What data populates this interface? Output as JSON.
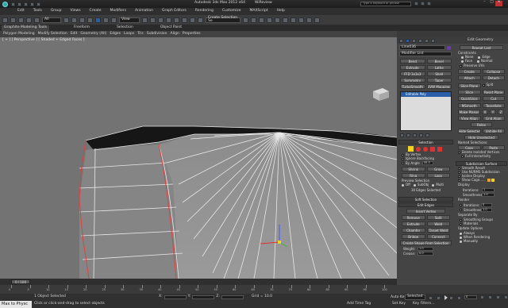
{
  "title_bar": {
    "title": "Autodesk 3ds Max 2012 x64",
    "file": "WiReview",
    "search_placeholder": "Type a keyword or phrase"
  },
  "menu": [
    "Edit",
    "Tools",
    "Group",
    "Views",
    "Create",
    "Modifiers",
    "Animation",
    "Graph Editors",
    "Rendering",
    "Customize",
    "MAXScript",
    "Help"
  ],
  "toolbar": {
    "selection_filter": "All",
    "ref_coord": "View",
    "named_selection": "Create Selection Se"
  },
  "ribbon_tabs": [
    "Graphite Modeling Tools",
    "Freeform",
    "Selection",
    "Object Paint"
  ],
  "ribbon_items": [
    "Polygon Modeling",
    "Modify Selection",
    "Edit",
    "Geometry (All)",
    "Edges",
    "Loops",
    "Tris",
    "Subdivision",
    "Align",
    "Properties"
  ],
  "viewport": {
    "label": "[ + ] [ Perspective ] [ Shaded + Edged Faces ]"
  },
  "command_panel": {
    "object_name": "Line036",
    "modifier_list": "Modifier List",
    "modifier_buttons": [
      "Bend",
      "Bevel",
      "Extrude",
      "Lathe",
      "FFD 3x3x3",
      "Shell",
      "Symmetry",
      "Taper",
      "TurboSmooth",
      "UVW Mapping Cle"
    ],
    "stack_item": "Editable Poly",
    "selection": {
      "title": "Selection",
      "by_vertex": "By Vertex",
      "ignore_backfacing": "Ignore Backfacing",
      "by_angle": "By Angle",
      "angle": "45.0",
      "shrink": "Shrink",
      "grow": "Grow",
      "ring": "Ring",
      "loop": "Loop",
      "preview": "Preview Selection",
      "off": "Off",
      "subobj": "SubObj",
      "multi": "Multi",
      "status": "30 Edges Selected"
    },
    "soft_selection": "Soft Selection",
    "edit_edges": {
      "title": "Edit Edges",
      "insert_vertex": "Insert Vertex",
      "remove": "Remove",
      "split": "Split",
      "extrude": "Extrude",
      "weld": "Weld",
      "chamfer": "Chamfer",
      "target_weld": "Target Weld",
      "bridge": "Bridge",
      "connect": "Connect",
      "create_shape": "Create Shape From Selection",
      "weight_label": "Weight:",
      "weight": "1.0",
      "crease_label": "Crease:",
      "crease": "0.0"
    }
  },
  "side_panel": {
    "edit_geometry": "Edit Geometry",
    "repeat_last": "Repeat Last",
    "constraints": "Constraints",
    "c_none": "None",
    "c_edge": "Edge",
    "c_face": "Face",
    "c_normal": "Normal",
    "preserve_uvs": "Preserve UVs",
    "create": "Create",
    "collapse": "Collapse",
    "attach": "Attach",
    "detach": "Detach",
    "slice_plane": "Slice Plane",
    "split": "Split",
    "slice": "Slice",
    "reset_plane": "Reset Plane",
    "quickslice": "QuickSlice",
    "cut": "Cut",
    "msmooth": "MSmooth",
    "tessellate": "Tessellate",
    "make_planar": "Make Planar",
    "x": "X",
    "y": "Y",
    "z": "Z",
    "view_align": "View Align",
    "grid_align": "Grid Align",
    "relax": "Relax",
    "hide_selected": "Hide Selected",
    "unhide_all": "Unhide All",
    "hide_unselected": "Hide Unselected",
    "named_selections": "Named Selections:",
    "copy": "Copy",
    "paste": "Paste",
    "delete_isolated": "Delete Isolated Vertices",
    "full_interactivity": "Full Interactivity",
    "subdivision_surface": "Subdivision Surface",
    "smooth_result": "Smooth Result",
    "use_nurms": "Use NURMS Subdivision",
    "isoline": "Isoline Display",
    "show_cage": "Show Cage......",
    "display": "Display",
    "iterations_label": "Iterations:",
    "iterations": "1",
    "smoothness_label": "Smoothness:",
    "smoothness": "1.0",
    "render": "Render",
    "r_iterations": "0",
    "r_smoothness": "1.0",
    "separate_by": "Separate By",
    "smoothing_groups": "Smoothing Groups",
    "materials": "Materials",
    "update_options": "Update Options",
    "always": "Always",
    "when_rendering": "When Rendering",
    "manually": "Manually"
  },
  "timeline": {
    "slider": "0 / 100",
    "ticks": [
      "0",
      "5",
      "10",
      "15",
      "20",
      "25",
      "30",
      "35",
      "40",
      "45",
      "50",
      "55",
      "60",
      "65",
      "70",
      "75",
      "80",
      "85",
      "90",
      "95",
      "100"
    ]
  },
  "status_bar": {
    "maxscript": "Max to Physc",
    "object_selected": "1 Object Selected",
    "prompt": "Click or click-and-drag to select objects",
    "x_label": "X:",
    "y_label": "Y:",
    "z_label": "Z:",
    "grid": "Grid = 10.0",
    "add_time_tag": "Add Time Tag",
    "auto_key": "Auto Key",
    "key_mode": "Selected",
    "set_key": "Set Key",
    "key_filters": "Key Filters...",
    "frame": "0"
  },
  "colors": {
    "accent": "#2a5ea8",
    "selected_edge": "#e04040",
    "vertex_yellow": "#f4d21f",
    "cage_orange": "#f0a020"
  }
}
